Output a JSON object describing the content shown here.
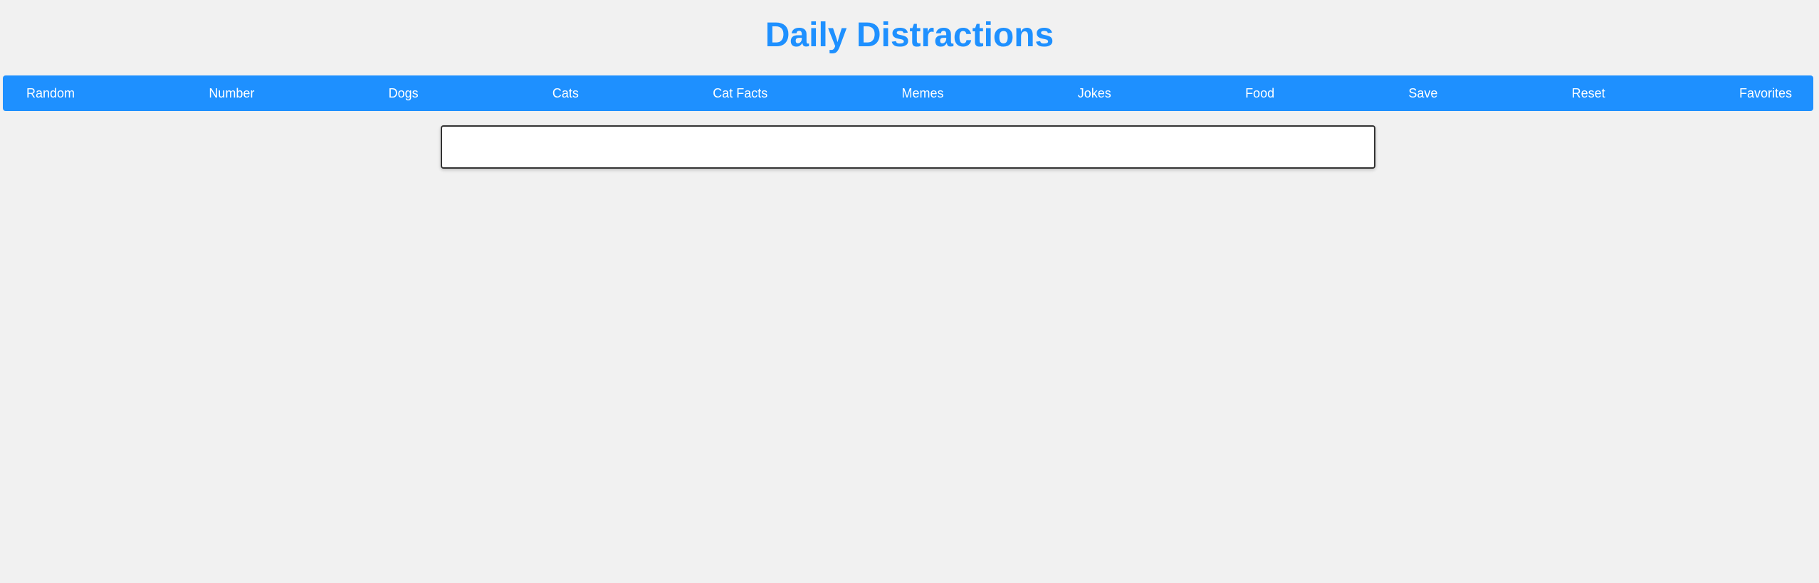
{
  "header": {
    "title": "Daily Distractions"
  },
  "nav": {
    "items": [
      {
        "label": "Random"
      },
      {
        "label": "Number"
      },
      {
        "label": "Dogs"
      },
      {
        "label": "Cats"
      },
      {
        "label": "Cat Facts"
      },
      {
        "label": "Memes"
      },
      {
        "label": "Jokes"
      },
      {
        "label": "Food"
      },
      {
        "label": "Save"
      },
      {
        "label": "Reset"
      },
      {
        "label": "Favorites"
      }
    ]
  },
  "colors": {
    "accent": "#1e90ff",
    "background": "#f1f1f1",
    "nav_text": "#ffffff",
    "content_border": "#333333"
  }
}
